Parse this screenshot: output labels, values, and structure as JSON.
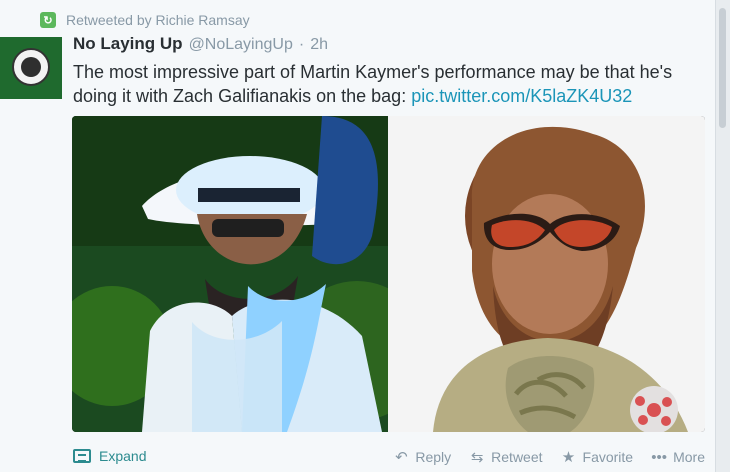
{
  "retweet": {
    "label": "Retweeted by Richie Ramsay"
  },
  "tweet": {
    "name": "No Laying Up",
    "handle": "@NoLayingUp",
    "separator": "·",
    "time": "2h",
    "text_main": "The most impressive part of Martin Kaymer's performance may be that he's doing it with Zach Galifianakis on the bag: ",
    "link": "pic.twitter.com/K5laZK4U32"
  },
  "actions": {
    "expand": "Expand",
    "reply": "Reply",
    "retweet": "Retweet",
    "favorite": "Favorite",
    "more": "More"
  }
}
